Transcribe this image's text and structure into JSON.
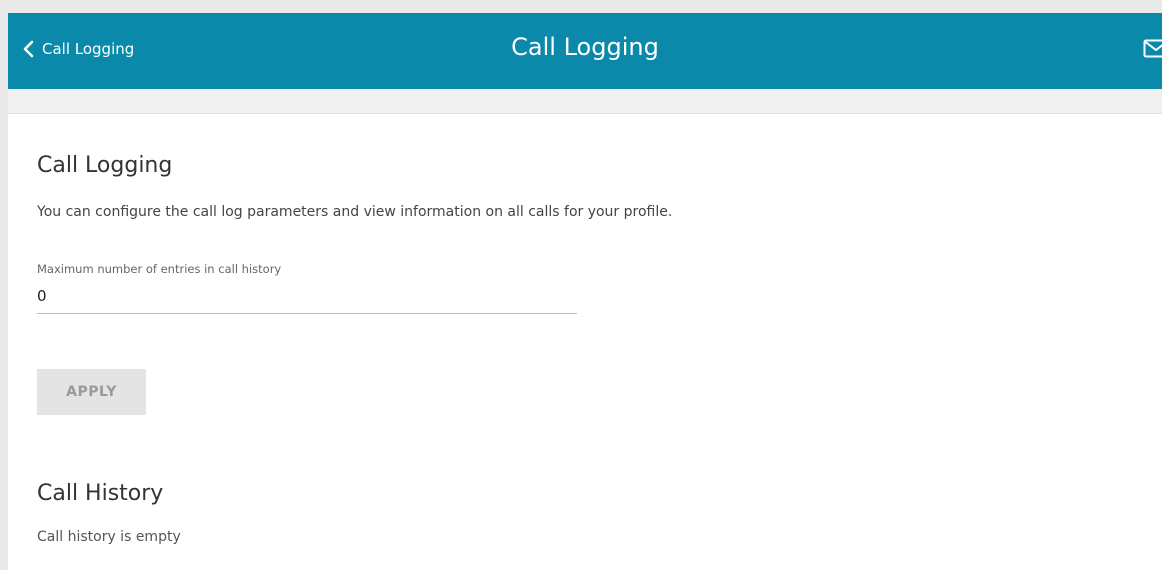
{
  "header": {
    "back_label": "Call Logging",
    "title": "Call Logging",
    "back_icon": "chevron-left-icon",
    "mail_icon": "mail-icon"
  },
  "call_logging": {
    "title": "Call Logging",
    "description": "You can configure the call log parameters and view information on all calls for your profile.",
    "max_entries_label": "Maximum number of entries in call history",
    "max_entries_value": "0",
    "apply_label": "APPLY"
  },
  "call_history": {
    "title": "Call History",
    "empty_text": "Call history is empty"
  },
  "colors": {
    "header_bg": "#0a89aa",
    "button_disabled_bg": "#e4e4e4",
    "button_disabled_text": "#9a9a9a"
  }
}
